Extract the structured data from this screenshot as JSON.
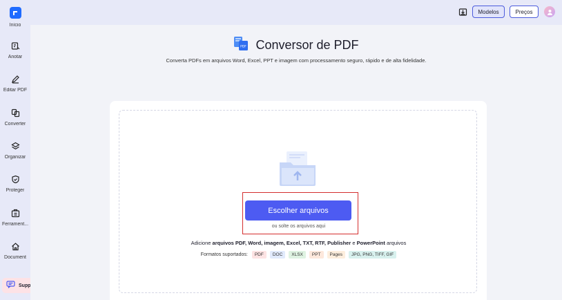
{
  "sidebar": {
    "items": [
      {
        "label": "Início",
        "icon": "home-logo-icon"
      },
      {
        "label": "Anotar",
        "icon": "annotate-icon"
      },
      {
        "label": "Editar PDF",
        "icon": "edit-icon"
      },
      {
        "label": "Converter",
        "icon": "convert-icon"
      },
      {
        "label": "Organizar",
        "icon": "layers-icon"
      },
      {
        "label": "Proteger",
        "icon": "shield-icon"
      },
      {
        "label": "Ferrament...",
        "icon": "tools-icon"
      },
      {
        "label": "Document",
        "icon": "house-icon"
      }
    ],
    "support_label": "Support"
  },
  "topbar": {
    "modelos_label": "Modelos",
    "precos_label": "Preços"
  },
  "main": {
    "title": "Conversor de PDF",
    "subtitle": "Converta PDFs em arquivos Word, Excel, PPT e imagem com processamento seguro, rápido e de alta fidelidade.",
    "choose_button": "Escolher arquivos",
    "drop_hint": "ou solte os arquivos aqui",
    "add_prefix": "Adicione ",
    "add_bold": "arquivos PDF, Word, imagem, Excel, TXT, RTF, Publisher",
    "add_mid": " e ",
    "add_bold2": "PowerPoint",
    "add_suffix": " arquivos",
    "formats_label": "Formatos suportados:",
    "formats": [
      {
        "label": "PDF",
        "color": "#fde3e3"
      },
      {
        "label": "DOC",
        "color": "#e1eafc"
      },
      {
        "label": "XLSX",
        "color": "#dff3e2"
      },
      {
        "label": "PPT",
        "color": "#fde8dc"
      },
      {
        "label": "Pages",
        "color": "#fdeedd"
      },
      {
        "label": "JPG, PNG, TIFF, GIF",
        "color": "#d8f1ee"
      }
    ]
  },
  "colors": {
    "accent": "#4d5bf2",
    "highlight": "#d42d2d"
  }
}
